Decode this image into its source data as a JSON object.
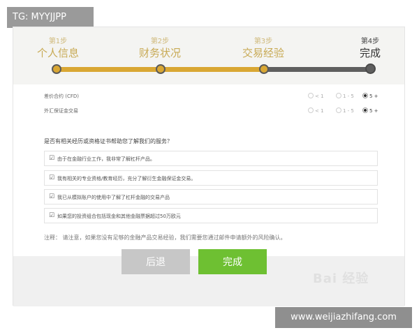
{
  "overlay": {
    "tg_label": "TG: MYYJJPP",
    "site_label": "www.weijiazhifang.com"
  },
  "steps": [
    {
      "num": "第1步",
      "name": "个人信息"
    },
    {
      "num": "第2步",
      "name": "财务状况"
    },
    {
      "num": "第3步",
      "name": "交易经验"
    },
    {
      "num": "第4步",
      "name": "完成"
    }
  ],
  "progress": {
    "current_step": 4,
    "total_steps": 4
  },
  "experience": {
    "rows": [
      {
        "label": "差价合约 (CFD)",
        "options": [
          "< 1",
          "1 - 5",
          "5 +"
        ],
        "selected": "5 +"
      },
      {
        "label": "外汇保证金交易",
        "options": [
          "< 1",
          "1 - 5",
          "5 +"
        ],
        "selected": "5 +"
      }
    ]
  },
  "question": "是否有相关经历或资格证书帮助您了解我们的服务？",
  "checkboxes": [
    {
      "text": "由于在金融行业工作，我非常了解杠杆产品。",
      "checked": true
    },
    {
      "text": "我有相关的专业资格/教育经历，充分了解衍生金融保证金交易。",
      "checked": true
    },
    {
      "text": "我已从模拟账户的使用中了解了杠杆金融的交易产品",
      "checked": true
    },
    {
      "text": "如果您的投资组合包括现金和其他金融票据超过50万欧元",
      "checked": true
    }
  ],
  "note": "注释： 请注意，如果您没有足够的金融产品交易经验，我们需要您通过邮件申请额外的风险确认。",
  "buttons": {
    "back": "后退",
    "done": "完成"
  },
  "watermark": "Bai 经验",
  "colors": {
    "accent_gold": "#d9a733",
    "done_green": "#6ec032",
    "back_gray": "#c7c7c7"
  }
}
